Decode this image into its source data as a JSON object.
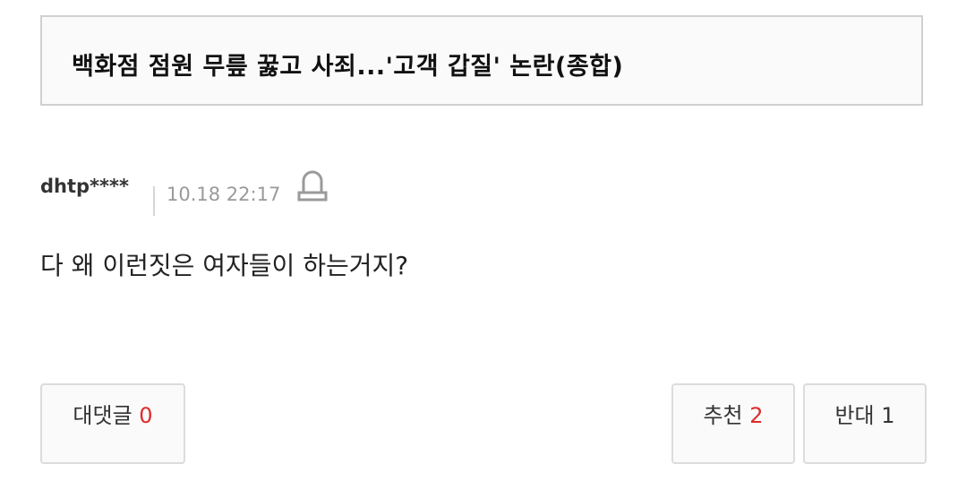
{
  "article": {
    "title": "백화점 점원 무릎 꿇고 사죄...'고객 갑질' 논란(종합)"
  },
  "comment": {
    "username": "dhtp****",
    "timestamp": "10.18 22:17",
    "text": "다 왜 이런짓은 여자들이 하는거지?"
  },
  "icons": {
    "report": "siren-report-icon"
  },
  "actions": {
    "replies_label": "대댓글",
    "replies_count": "0",
    "like_label": "추천",
    "like_count": "2",
    "dislike_label": "반대",
    "dislike_count": "1"
  },
  "colors": {
    "count_highlight": "#e02a2a",
    "border": "#d0d0d0",
    "timestamp": "#9a9a9a"
  }
}
